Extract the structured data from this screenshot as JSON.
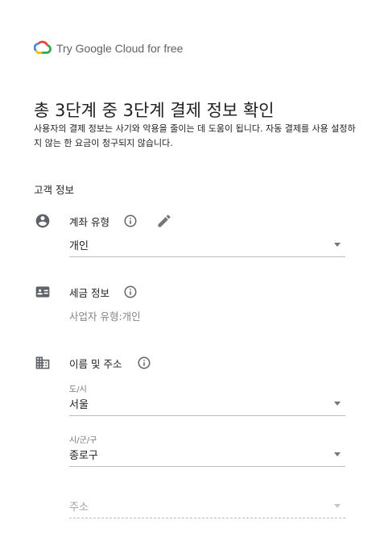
{
  "brand": {
    "text": "Try Google Cloud for free",
    "icon": "google-cloud-logo"
  },
  "header": {
    "title": "총 3단계 중 3단계 결제 정보 확인",
    "description": "사용자의 결제 정보는 사기와 악용을 줄이는 데 도움이 됩니다. 자동 결제를 사용 설정하지 않는 한 요금이 청구되지 않습니다."
  },
  "section": {
    "label": "고객 정보"
  },
  "account_type": {
    "label": "계좌 유형",
    "value": "개인"
  },
  "tax_info": {
    "label": "세금 정보",
    "value": "사업자 유형:개인"
  },
  "name_address": {
    "label": "이름 및 주소",
    "city": {
      "label": "도/시",
      "value": "서울"
    },
    "district": {
      "label": "시/군/구",
      "value": "종로구"
    },
    "address": {
      "placeholder": "주소"
    }
  },
  "colors": {
    "icon": "#5f6368",
    "divider": "#bdbdbd",
    "muted": "#80868b"
  }
}
